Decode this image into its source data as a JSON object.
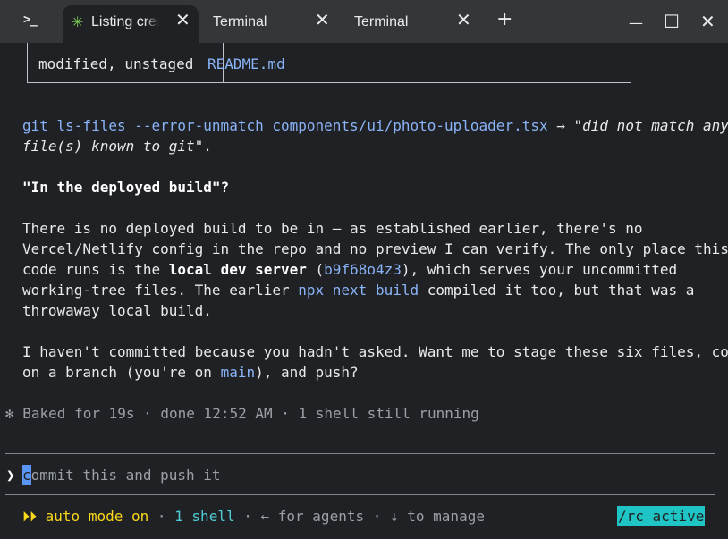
{
  "tabs": [
    {
      "label": "Listing crea",
      "active": true,
      "icon": "sparkle-icon"
    },
    {
      "label": "Terminal",
      "active": false
    },
    {
      "label": "Terminal",
      "active": false
    }
  ],
  "titlebar": {
    "app_icon": ">_",
    "new_tab": "+",
    "close_glyph": "✕",
    "minimize": "—",
    "maximize": "☐",
    "close": "✕"
  },
  "table": {
    "status": "modified, unstaged",
    "file": "README.md"
  },
  "messages": {
    "git_cmd": "git ls-files --error-unmatch components/ui/photo-uploader.tsx",
    "arrow": " → ",
    "git_result_1": "\"did not match any",
    "git_result_2": "file(s) known to git\"",
    "git_result_end": ".",
    "heading": "\"In the deployed build\"?",
    "p1_l1": "There is no deployed build to be in — as established earlier, there's no",
    "p1_l2": "Vercel/Netlify config in the repo and no preview I can verify. The only place this",
    "p1_l3_a": "code runs is the ",
    "p1_l3_b": "local dev server",
    "p1_l3_c": " (",
    "p1_l3_hash": "b9f68o4z3",
    "p1_l3_d": "), which serves your uncommitted",
    "p1_l4_a": "working-tree files. The earlier ",
    "p1_l4_cmd": "npx next build",
    "p1_l4_b": " compiled it too, but that was a",
    "p1_l5": "throwaway local build.",
    "p2_l1": "I haven't committed because you hadn't asked. Want me to stage these six files, commit",
    "p2_l2_a": "on a branch (you're on ",
    "p2_l2_branch": "main",
    "p2_l2_b": "), and push?"
  },
  "status_line": {
    "icon": "✻",
    "text": " Baked for 19s · done 12:52 AM · 1 shell still running"
  },
  "prompt": {
    "caret": "❯",
    "cursor_char": "c",
    "placeholder_rest": "ommit this and push it"
  },
  "footer": {
    "mode_icon": "⏵⏵",
    "mode": " auto mode on",
    "sep1": " · ",
    "shells": "1 shell",
    "sep2": " · ",
    "agents": "← for agents",
    "sep3": " · ",
    "manage": "↓ to manage",
    "rc": "/rc active"
  },
  "colors": {
    "background": "#202124",
    "link_blue": "#8ab4f8",
    "mode_yellow": "#f9d71c",
    "shell_cyan": "#4ecdd6",
    "rc_badge": "#1fc4c4",
    "cursor": "#5a95f5"
  }
}
